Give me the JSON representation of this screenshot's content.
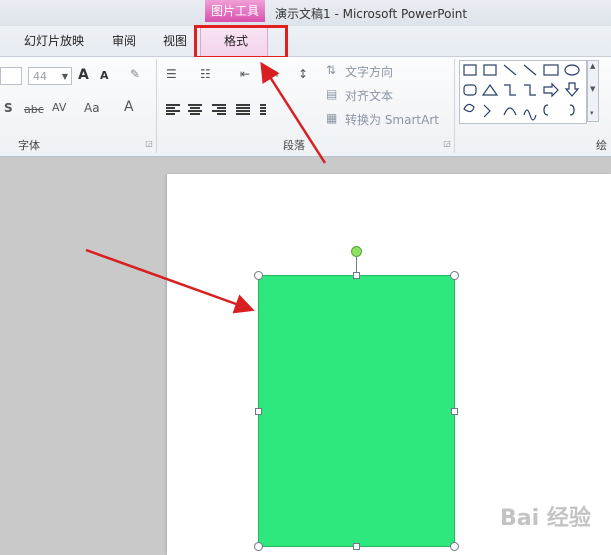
{
  "titlebar": {
    "context_tab": "图片工具",
    "window_title": "演示文稿1 - Microsoft PowerPoint"
  },
  "tabs": [
    {
      "label": "幻灯片放映"
    },
    {
      "label": "审阅"
    },
    {
      "label": "视图"
    },
    {
      "label": "格式",
      "active": true
    }
  ],
  "ribbon": {
    "font": {
      "size_value": "44",
      "group_label": "字体",
      "grow_label": "A",
      "shrink_label": "A",
      "bold_shadow": "S",
      "strike": "abc",
      "spacing": "AV",
      "case": "Aa",
      "color": "A"
    },
    "paragraph": {
      "text_direction": "文字方向",
      "align_text": "对齐文本",
      "convert_smartart": "转换为 SmartArt",
      "group_label": "段落"
    },
    "drawing": {
      "group_label": "绘"
    }
  },
  "watermark": "Bai 经验",
  "colors": {
    "shape_fill": "#2fe87d",
    "annotation": "#e0201f",
    "context_tab": "#d84fae"
  }
}
